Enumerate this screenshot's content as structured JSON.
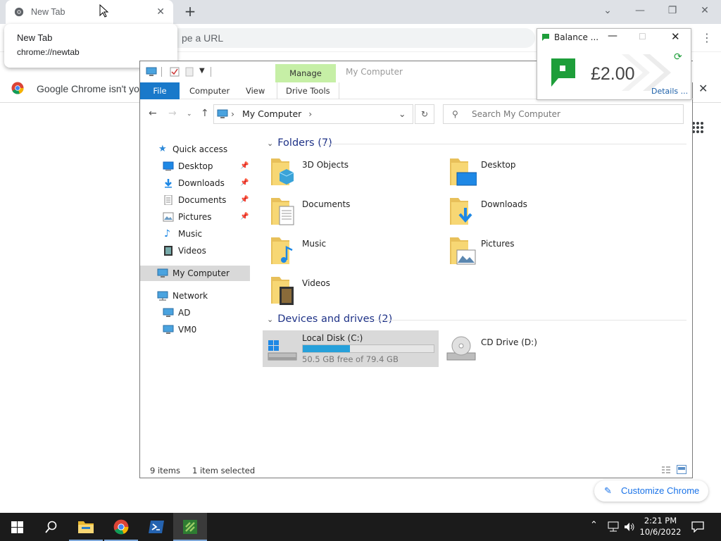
{
  "browser": {
    "tab_title": "New Tab",
    "omnibox_placeholder": "Search Google or type a URL",
    "omnibox_visible": "pe a URL",
    "infobar_text": "Google Chrome isn't your",
    "customize_label": "Customize Chrome"
  },
  "tooltip": {
    "title": "New Tab",
    "url": "chrome://newtab"
  },
  "explorer": {
    "ribbon": {
      "manage": "Manage",
      "window_title": "My Computer",
      "file": "File",
      "computer": "Computer",
      "view": "View",
      "drive_tools": "Drive Tools"
    },
    "address": {
      "crumb": "My Computer",
      "search_placeholder": "Search My Computer"
    },
    "nav": {
      "quick_access": "Quick access",
      "desktop": "Desktop",
      "downloads": "Downloads",
      "documents": "Documents",
      "pictures": "Pictures",
      "music": "Music",
      "videos": "Videos",
      "my_computer": "My Computer",
      "network": "Network",
      "ad": "AD",
      "vm0": "VM0"
    },
    "groups": {
      "folders": "Folders (7)",
      "devices": "Devices and drives (2)"
    },
    "folders": {
      "objects3d": "3D Objects",
      "desktop": "Desktop",
      "documents": "Documents",
      "downloads": "Downloads",
      "music": "Music",
      "pictures": "Pictures",
      "videos": "Videos"
    },
    "drives": {
      "c_name": "Local Disk (C:)",
      "c_free": "50.5 GB free of 79.4 GB",
      "c_used_fraction": 0.36,
      "d_name": "CD Drive (D:)"
    },
    "status": {
      "items": "9 items",
      "selected": "1 item selected"
    }
  },
  "balance": {
    "title": "Balance ...",
    "amount": "£2.00",
    "details": "Details ..."
  },
  "taskbar": {
    "time": "2:21 PM",
    "date": "10/6/2022"
  }
}
